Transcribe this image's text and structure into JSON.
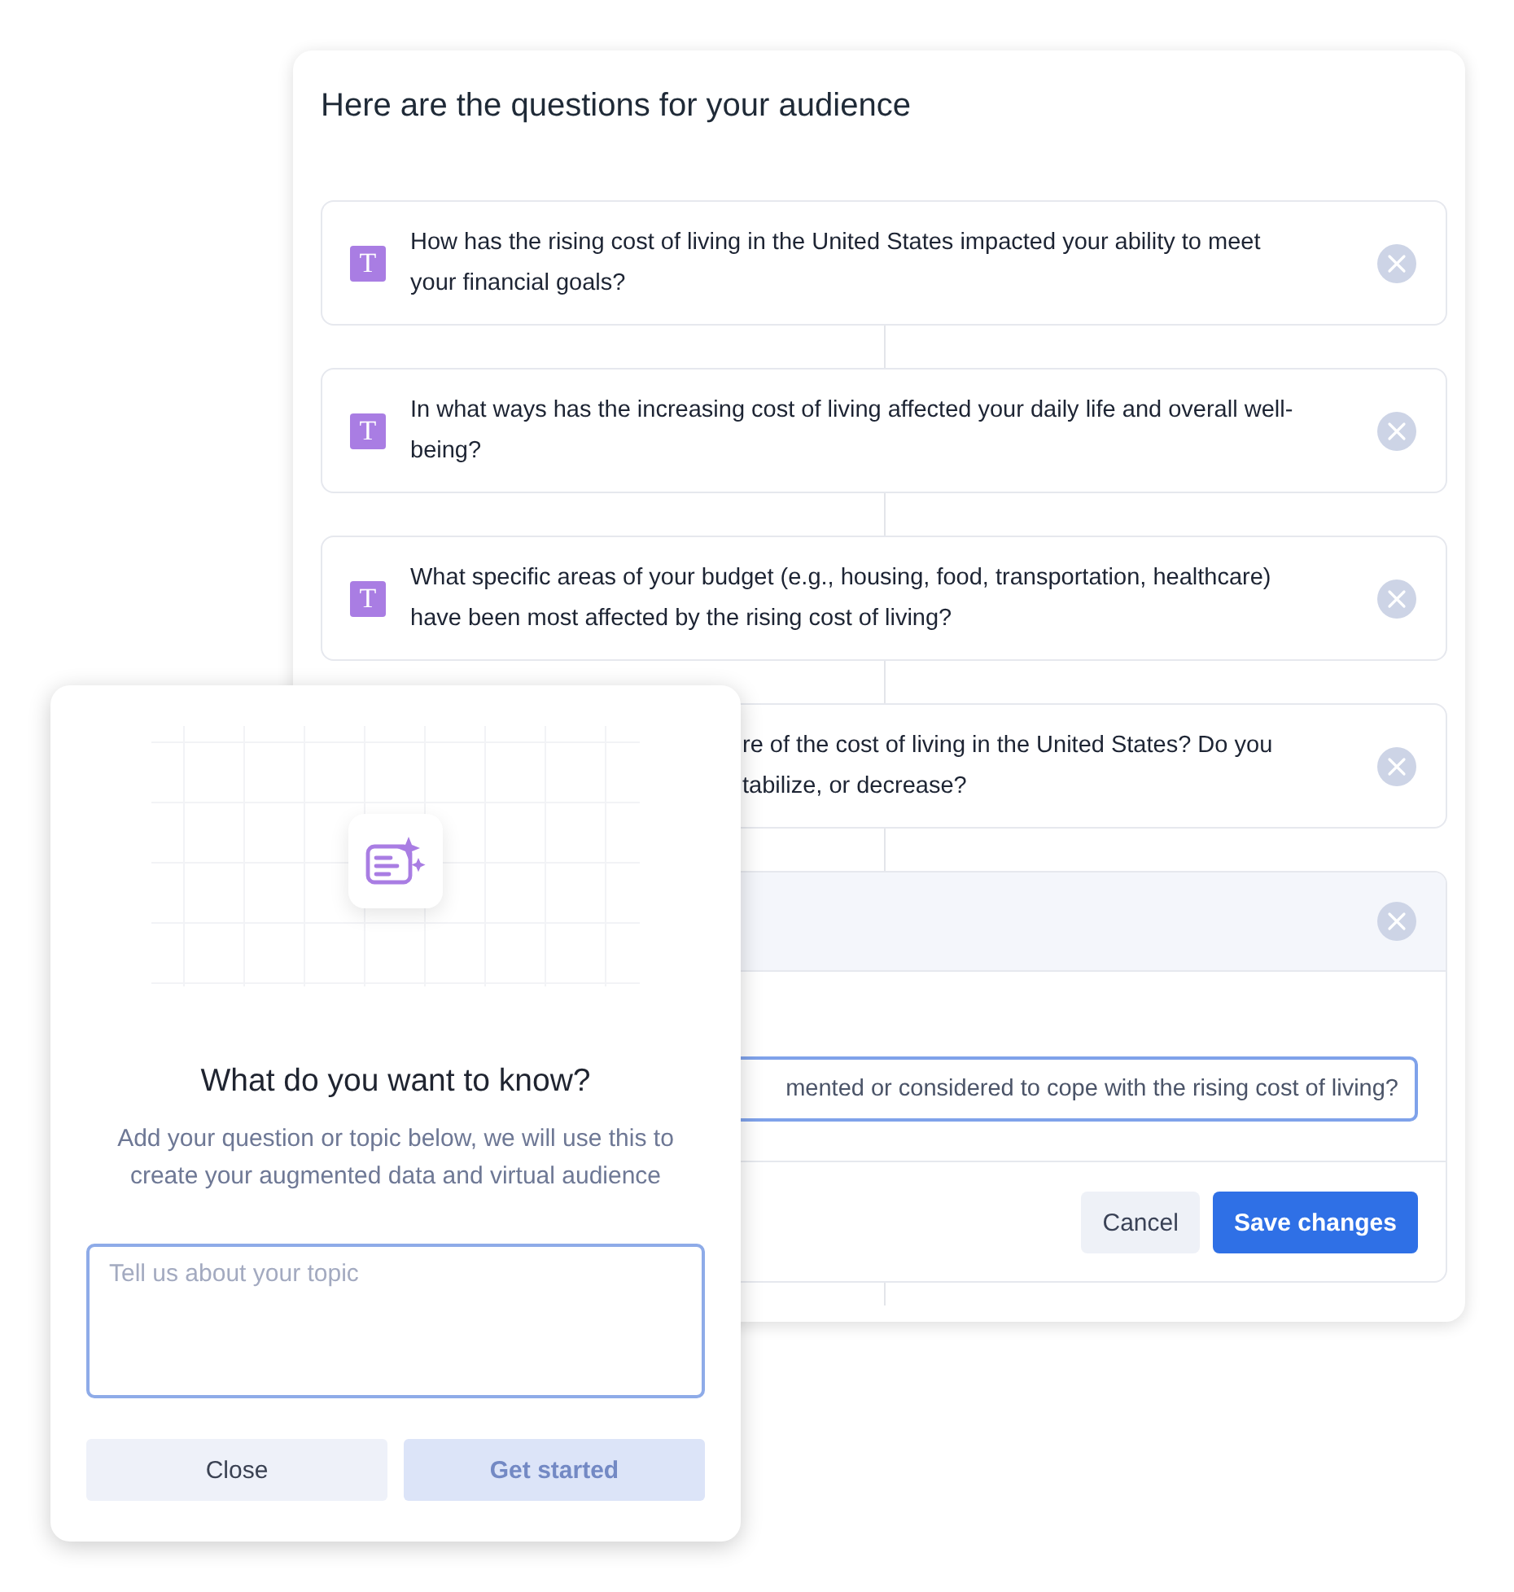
{
  "questions_panel": {
    "title": "Here are the questions for your audience",
    "questions": [
      {
        "kind": "text",
        "badge": "T",
        "text": "How has the rising cost of living in the United States impacted your ability to meet your financial goals?"
      },
      {
        "kind": "text",
        "badge": "T",
        "text": "In what ways has the increasing cost of living affected your daily life and overall well-being?"
      },
      {
        "kind": "text",
        "badge": "T",
        "text": "What specific areas of your budget (e.g., housing, food, transportation, healthcare) have been most affected by the rising cost of living?"
      },
      {
        "kind": "partial",
        "lines": [
          "re of the cost of living in the United States? Do you",
          "tabilize, or decrease?"
        ]
      }
    ],
    "editor": {
      "value": "mented or considered to cope with the rising cost of living?",
      "buttons": [
        {
          "kind": "secondary",
          "label": "Cancel"
        },
        {
          "kind": "primary",
          "label": "Save changes"
        }
      ]
    }
  },
  "topic_dialog": {
    "title": "What do you want to know?",
    "subtitle": "Add your question or topic below, we will use this to create your augmented data and virtual audience",
    "topic_field": {
      "placeholder": "Tell us about your topic"
    },
    "buttons": [
      {
        "label": "Close",
        "disabled": false
      },
      {
        "label": "Get started",
        "disabled": true
      }
    ]
  }
}
